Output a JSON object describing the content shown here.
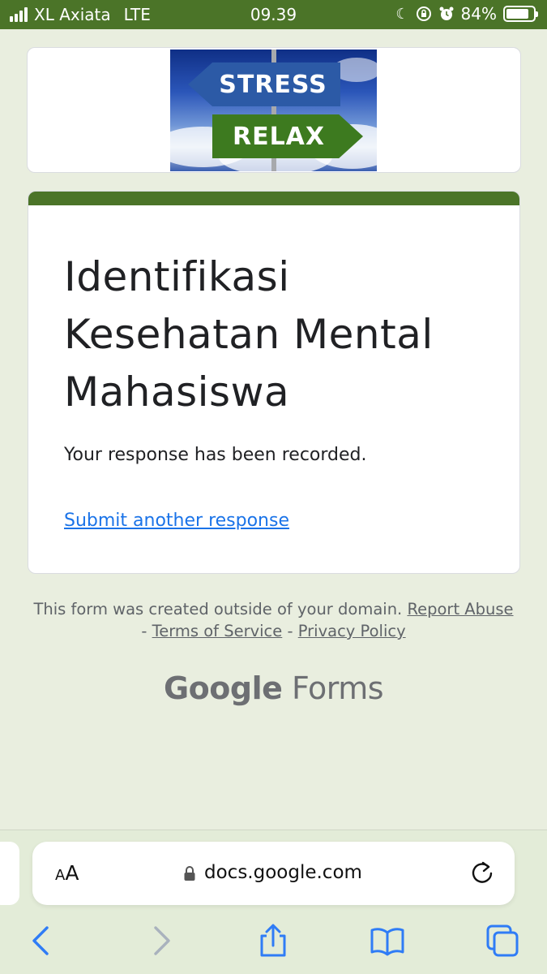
{
  "status_bar": {
    "carrier": "XL Axiata",
    "network": "LTE",
    "time": "09.39",
    "battery_percent": "84%",
    "battery_level": 0.84,
    "icons": [
      "signal-icon",
      "moon-icon",
      "rotation-lock-icon",
      "alarm-icon",
      "battery-icon"
    ]
  },
  "banner": {
    "sign_top": "STRESS",
    "sign_bottom": "RELAX"
  },
  "form": {
    "title": "Identifikasi Kesehatan Mental Mahasiswa",
    "confirmation": "Your response has been recorded.",
    "submit_another": "Submit another response",
    "accent_color": "#4b7428"
  },
  "footer": {
    "notice": "This form was created outside of your domain.",
    "report_abuse": "Report Abuse",
    "separator": "-",
    "terms": "Terms of Service",
    "privacy": "Privacy Policy",
    "brand_google": "Google",
    "brand_forms": "Forms"
  },
  "browser": {
    "text_size_small": "A",
    "text_size_big": "A",
    "url": "docs.google.com",
    "icons": [
      "lock-icon",
      "reload-icon",
      "back-icon",
      "forward-icon",
      "share-icon",
      "bookmarks-icon",
      "tabs-icon"
    ],
    "link_color": "#1a73e8"
  }
}
